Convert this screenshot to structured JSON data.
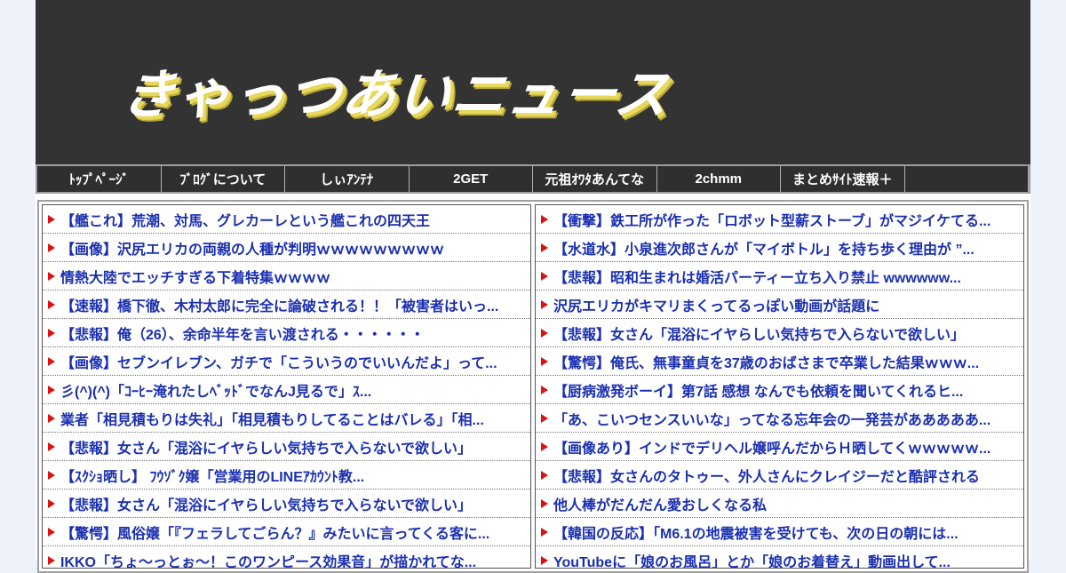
{
  "site": {
    "logo_text": "きゃっつあいニュース"
  },
  "nav": [
    "ﾄｯﾌﾟﾍﾟｰｼﾞ",
    "ﾌﾞﾛｸﾞについて",
    "しぃｱﾝﾃﾅ",
    "2GET",
    "元祖ｵﾜﾀあんてな",
    "2chmm",
    "まとめｻｲﾄ速報＋",
    ""
  ],
  "left_items": [
    "【艦これ】荒潮、対馬、グレカーレという艦これの四天王",
    "【画像】沢尻エリカの両親の人種が判明ｗｗｗｗｗｗｗｗｗ",
    "情熱大陸でエッチすぎる下着特集ｗｗｗｗ",
    "【速報】橋下徹、木村太郎に完全に論破される！！「被害者はいっ...",
    "【悲報】俺（26）、余命半年を言い渡される・・・・・・",
    "【画像】セブンイレブン、ガチで「こういうのでいいんだよ」って...",
    "彡(^)(^)「ｺｰﾋｰ淹れたしﾍﾞｯﾄﾞでなんJ見るで」ｽ...",
    "業者「相見積もりは失礼」「相見積もりしてることはバレる」「相...",
    "【悲報】女さん「混浴にイヤらしい気持ちで入らないで欲しい」",
    "【ｽｸｼｮ晒し】 ﾌｳｿﾞｸ嬢「営業用のLINEｱｶｳﾝﾄ教...",
    "【悲報】女さん「混浴にイヤらしい気持ちで入らないで欲しい」",
    "【驚愕】風俗嬢「『フェラしてごらん？』みたいに言ってくる客に...",
    "IKKO「ちょ〜っとぉ〜！このワンピース効果音」が描かれてな..."
  ],
  "right_items": [
    "【衝撃】鉄工所が作った「ロボット型薪ストーブ」がマジイケてる...",
    "【水道水】小泉進次郎さんが「マイボトル」を持ち歩く理由が ”...",
    "【悲報】昭和生まれは婚活パーティー立ち入り禁止 wwwwww...",
    "沢尻エリカがキマリまくってるっぽい動画が話題に",
    "【悲報】女さん「混浴にイヤらしい気持ちで入らないで欲しい」",
    "【驚愕】俺氏、無事童貞を37歳のおばさまで卒業した結果ｗｗｗ...",
    "【厨病激発ボーイ】第7話 感想 なんでも依頼を聞いてくれるヒ...",
    "「あ、こいつセンスいいな」ってなる忘年会の一発芸があああああ...",
    "【画像あり】インドでデリヘル嬢呼んだからＨ晒してくｗｗｗｗｗ...",
    "【悲報】女さんのタトゥー、外人さんにクレイジーだと酷評される",
    "他人棒がだんだん愛おしくなる私",
    "【韓国の反応】「M6.1の地震被害を受けても、次の日の朝には...",
    "YouTubeに「娘のお風呂」とか「娘のお着替え」動画出して..."
  ]
}
